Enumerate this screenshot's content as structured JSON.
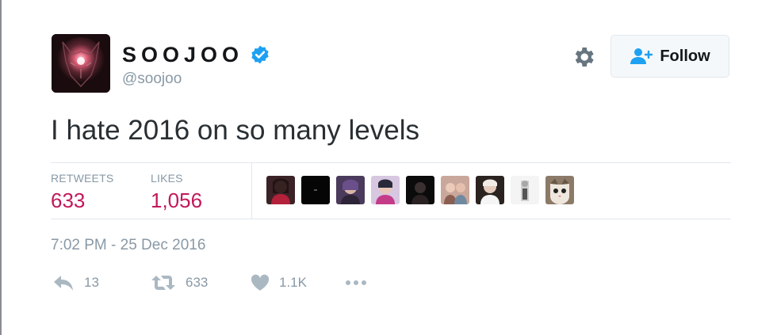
{
  "user": {
    "display_name": "SOOJOO",
    "handle": "@soojoo",
    "verified": true,
    "avatar_icon": "wolf-avatar"
  },
  "header": {
    "settings_icon": "gear-icon",
    "follow_label": "Follow",
    "follow_icon": "add-user-icon"
  },
  "tweet": {
    "text": "I hate 2016 on so many levels"
  },
  "stats": {
    "retweets_label": "RETWEETS",
    "retweets_value": "633",
    "likes_label": "LIKES",
    "likes_value": "1,056"
  },
  "likers_count_shown": 9,
  "timestamp": "7:02 PM - 25 Dec 2016",
  "actions": {
    "reply_count": "13",
    "retweet_count": "633",
    "like_count": "1.1K",
    "more_icon": "more-dots-icon"
  },
  "colors": {
    "accent_pink": "#c2185b",
    "muted_gray": "#8899a6",
    "verified_blue": "#1da1f2"
  }
}
